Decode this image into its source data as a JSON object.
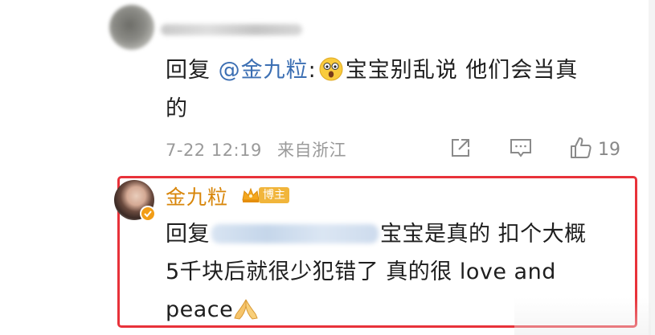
{
  "comment1": {
    "reply_prefix": "回复",
    "mention": "@金九粒",
    "colon": ":",
    "emoji": "surprised-face-icon",
    "text_line1": "宝宝别乱说 他们会当真",
    "text_line2": "的",
    "timestamp": "7-22 12:19",
    "location": "来自浙江",
    "like_count": "19"
  },
  "comment2": {
    "username": "金九粒",
    "badge_label": "博主",
    "reply_prefix": "回复",
    "text_line1": "宝宝是真的 扣个大概",
    "text_line2": "5千块后就很少犯错了 真的很 love and",
    "text_line3": "peace",
    "emoji": "folded-hands-icon"
  },
  "colors": {
    "mention_blue": "#3c6fb3",
    "username_gold": "#d8860a",
    "highlight_red": "#e8323a",
    "meta_gray": "#9a9a9a"
  }
}
